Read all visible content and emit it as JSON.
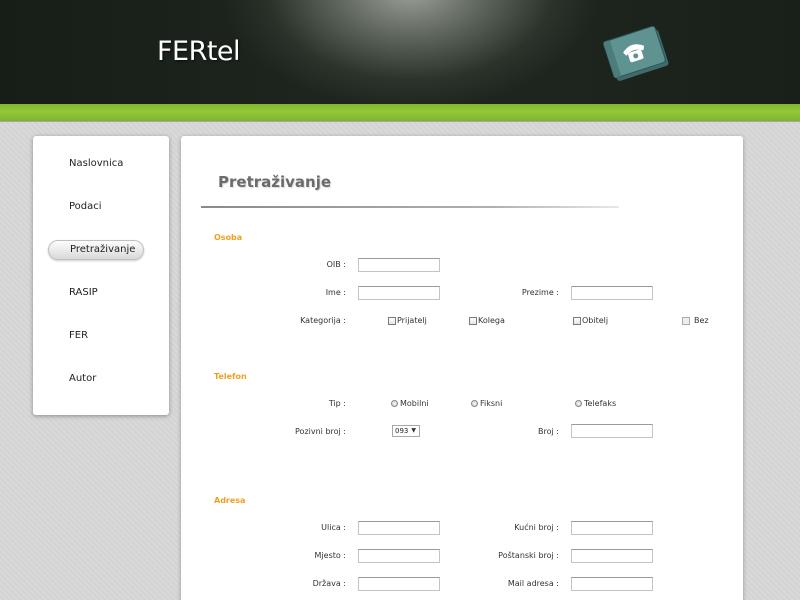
{
  "header": {
    "logo_text": "FERtel"
  },
  "sidebar": {
    "items": [
      {
        "label": "Naslovnica"
      },
      {
        "label": "Podaci"
      },
      {
        "label": "Pretraživanje",
        "active": true
      },
      {
        "label": "RASIP"
      },
      {
        "label": "FER"
      },
      {
        "label": "Autor"
      }
    ]
  },
  "main": {
    "title": "Pretraživanje",
    "osoba": {
      "section": "Osoba",
      "oib_label": "OIB :",
      "oib_value": "",
      "ime_label": "Ime :",
      "ime_value": "",
      "prezime_label": "Prezime :",
      "prezime_value": "",
      "kategorija_label": "Kategorija :",
      "kategorije": [
        "Prijatelj",
        "Kolega",
        "Obitelj",
        "Bez"
      ]
    },
    "telefon": {
      "section": "Telefon",
      "tip_label": "Tip :",
      "tipovi": [
        "Mobilni",
        "Fiksni",
        "Telefaks"
      ],
      "pozivni_label": "Pozivni broj :",
      "pozivni_value": "093",
      "broj_label": "Broj :",
      "broj_value": ""
    },
    "adresa": {
      "section": "Adresa",
      "ulica_label": "Ulica :",
      "kucni_label": "Kućni broj :",
      "mjesto_label": "Mjesto :",
      "postanski_label": "Poštanski broj :",
      "drzava_label": "Država :",
      "mail_label": "Mail adresa :"
    }
  },
  "colors": {
    "accent_green": "#8bc34a",
    "section_orange": "#f0a020",
    "header_dark": "#1e251e"
  }
}
